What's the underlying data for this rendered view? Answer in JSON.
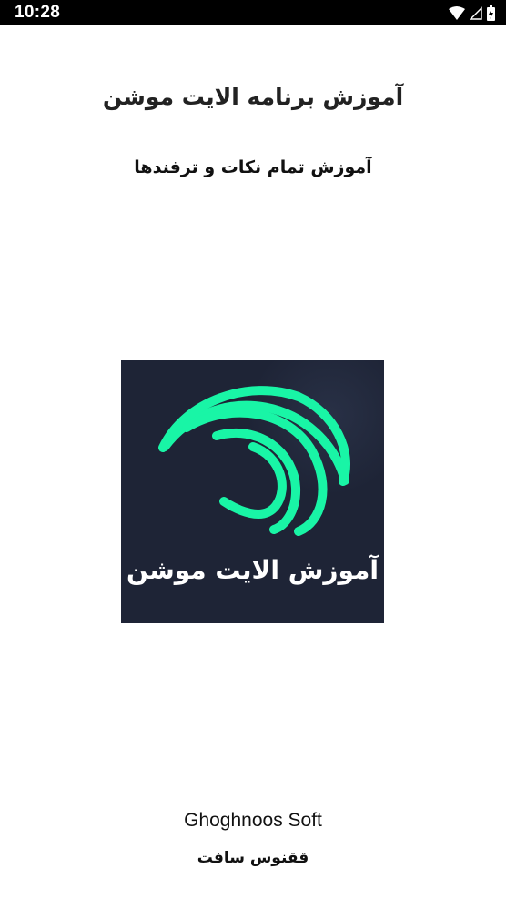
{
  "status_bar": {
    "time": "10:28",
    "icons": [
      "wifi-icon",
      "cellular-signal-icon",
      "battery-charging-icon"
    ]
  },
  "splash": {
    "title": "آموزش برنامه الایت موشن",
    "subtitle": "آموزش تمام نکات و ترفندها",
    "logo": {
      "text": "آموزش الایت موشن",
      "background_color": "#1e2436",
      "accent_color": "#19f5a6"
    },
    "company_name": "Ghoghnoos Soft",
    "company_name_fa": "ققنوس سافت"
  }
}
